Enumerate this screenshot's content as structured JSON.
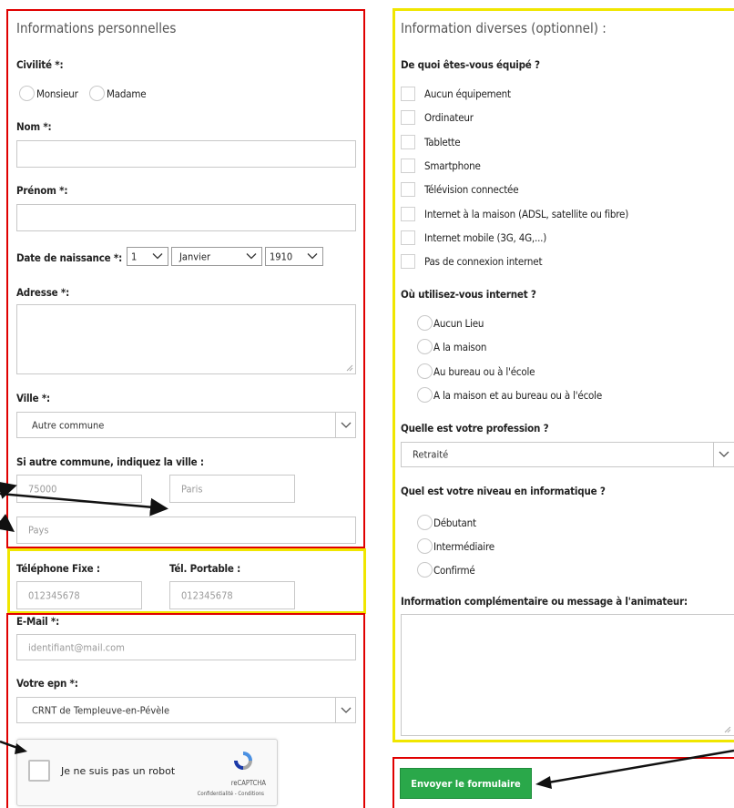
{
  "left": {
    "title": "Informations personnelles",
    "civilite_label": "Civilité *:",
    "civilite_options": [
      "Monsieur",
      "Madame"
    ],
    "nom_label": "Nom *:",
    "prenom_label": "Prénom *:",
    "dob_label": "Date de naissance *:",
    "dob_day": "1",
    "dob_month": "Janvier",
    "dob_year": "1910",
    "adresse_label": "Adresse *:",
    "ville_label": "Ville *:",
    "ville_value": "Autre commune",
    "autre_label": "Si autre commune, indiquez la ville :",
    "cp_placeholder": "75000",
    "ville_placeholder": "Paris",
    "pays_placeholder": "Pays",
    "tel_fixe_label": "Téléphone Fixe :",
    "tel_port_label": "Tél. Portable :",
    "tel_fixe_placeholder": "012345678",
    "tel_port_placeholder": "012345678",
    "email_label": "E-Mail *:",
    "email_placeholder": "identifiant@mail.com",
    "epn_label": "Votre epn *:",
    "epn_value": "CRNT de Templeuve-en-Pévèle",
    "captcha_text": "Je ne suis pas un robot",
    "captcha_brand": "reCAPTCHA",
    "captcha_links": "Confidentialité - Conditions"
  },
  "right": {
    "title": "Information diverses (optionnel) :",
    "equip_label": "De quoi êtes-vous équipé ?",
    "equip_items": [
      "Aucun équipement",
      "Ordinateur",
      "Tablette",
      "Smartphone",
      "Télévision connectée",
      "Internet à la maison (ADSL, satellite ou fibre)",
      "Internet mobile (3G, 4G,...)",
      "Pas de connexion internet"
    ],
    "internet_label": "Où utilisez-vous internet ?",
    "internet_items": [
      "Aucun Lieu",
      "A la maison",
      "Au bureau ou à l'école",
      "A la maison et au bureau ou à l'école"
    ],
    "profession_label": "Quelle est votre profession ?",
    "profession_value": "Retraité",
    "niveau_label": "Quel est votre niveau en informatique ?",
    "niveau_items": [
      "Débutant",
      "Intermédiaire",
      "Confirmé"
    ],
    "message_label": "Information complémentaire ou message à l'animateur:",
    "submit_label": "Envoyer le formulaire"
  },
  "colors": {
    "highlight_red": "#e00000",
    "highlight_yellow": "#f0e600",
    "submit_green": "#2aa84a"
  }
}
